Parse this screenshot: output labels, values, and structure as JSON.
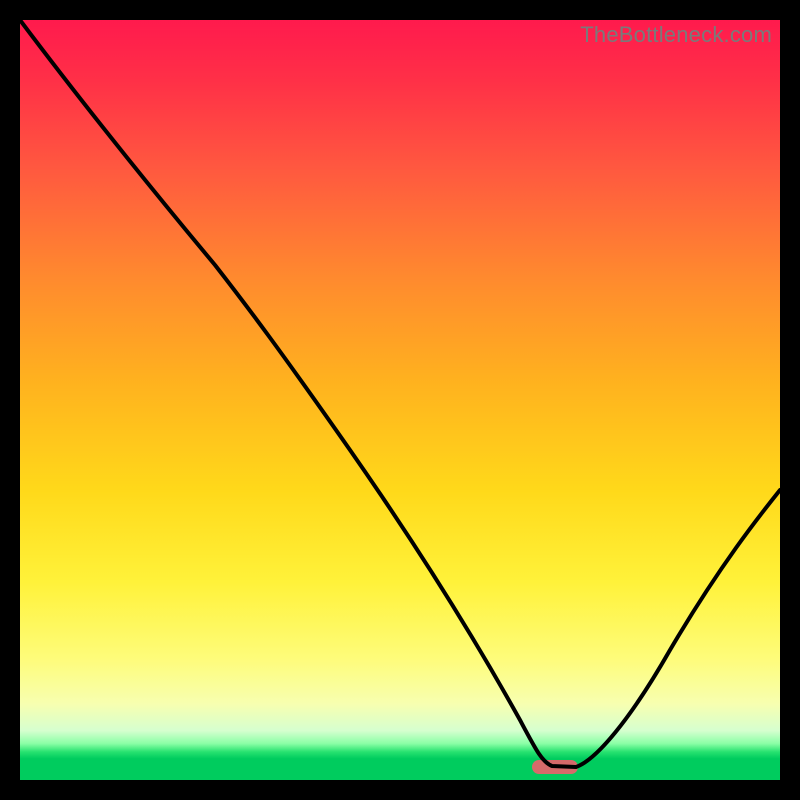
{
  "watermark": "TheBottleneck.com",
  "colors": {
    "frame_bg": "#000000",
    "gradient_top": "#ff1a4d",
    "gradient_mid": "#ffd91a",
    "gradient_bottom": "#00cc5e",
    "curve": "#000000",
    "marker": "#d56a6a"
  },
  "chart_data": {
    "type": "line",
    "title": "",
    "xlabel": "",
    "ylabel": "",
    "xlim": [
      0,
      100
    ],
    "ylim": [
      0,
      100
    ],
    "note": "No axis ticks or numeric labels are rendered in the image; values are positional estimates from pixels.",
    "series": [
      {
        "name": "bottleneck-curve",
        "x": [
          0,
          8,
          18,
          28,
          38,
          48,
          58,
          64,
          68,
          72,
          76,
          80,
          86,
          92,
          100
        ],
        "values": [
          100,
          89,
          77,
          68,
          55,
          41,
          26,
          14,
          6,
          2,
          2,
          4,
          12,
          22,
          38
        ]
      }
    ],
    "marker": {
      "x_center": 71,
      "y": 1.5,
      "width_pct": 6
    }
  }
}
